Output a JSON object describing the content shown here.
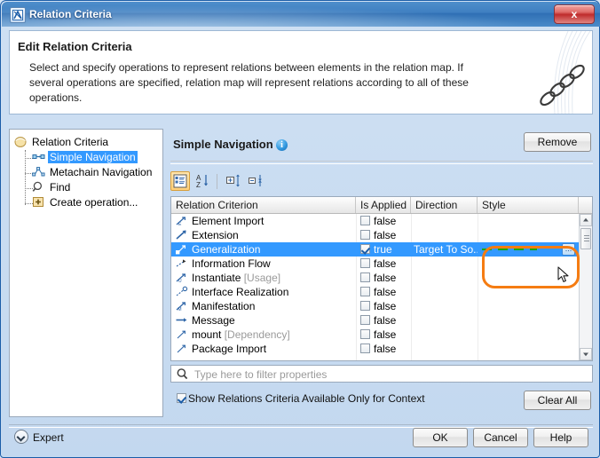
{
  "window": {
    "title": "Relation Criteria",
    "icon": "app-icon",
    "close_label": "x"
  },
  "banner": {
    "title": "Edit Relation Criteria",
    "description": "Select and specify operations to represent relations between elements in the relation map. If several operations are specified, relation map will represent relations according to all of these operations.",
    "decoration": "chain-link-image"
  },
  "tree": {
    "root": {
      "label": "Relation Criteria",
      "icon": "folder-icon"
    },
    "items": [
      {
        "label": "Simple Navigation",
        "icon": "simple-navigation-icon",
        "selected": true
      },
      {
        "label": "Metachain Navigation",
        "icon": "metachain-navigation-icon",
        "selected": false
      },
      {
        "label": "Find",
        "icon": "find-magnifier-icon",
        "selected": false
      },
      {
        "label": "Create operation...",
        "icon": "create-plus-icon",
        "selected": false
      }
    ]
  },
  "panel": {
    "section_title": "Simple Navigation",
    "info_icon_glyph": "i",
    "remove_label": "Remove",
    "toolbar": [
      {
        "name": "categorized-view-icon",
        "active": true
      },
      {
        "name": "alphabetic-sort-icon",
        "active": false
      },
      {
        "name": "expand-all-icon",
        "active": false
      },
      {
        "name": "collapse-all-icon",
        "active": false
      }
    ]
  },
  "table": {
    "columns": [
      "Relation Criterion",
      "Is Applied",
      "Direction",
      "Style"
    ],
    "rows": [
      {
        "name": "Element Import",
        "suffix": "",
        "icon": "element-import-icon",
        "applied": false,
        "applied_text": "false",
        "direction": "",
        "style": "",
        "selected": false
      },
      {
        "name": "Extension",
        "suffix": "",
        "icon": "extension-icon",
        "applied": false,
        "applied_text": "false",
        "direction": "",
        "style": "",
        "selected": false
      },
      {
        "name": "Generalization",
        "suffix": "",
        "icon": "generalization-icon",
        "applied": true,
        "applied_text": "true",
        "direction": "Target To So...",
        "style": "dashed-green-line",
        "selected": true
      },
      {
        "name": "Information Flow",
        "suffix": "",
        "icon": "information-flow-icon",
        "applied": false,
        "applied_text": "false",
        "direction": "",
        "style": "",
        "selected": false
      },
      {
        "name": "Instantiate",
        "suffix": "[Usage]",
        "icon": "instantiate-icon",
        "applied": false,
        "applied_text": "false",
        "direction": "",
        "style": "",
        "selected": false
      },
      {
        "name": "Interface Realization",
        "suffix": "",
        "icon": "interface-realization-icon",
        "applied": false,
        "applied_text": "false",
        "direction": "",
        "style": "",
        "selected": false
      },
      {
        "name": "Manifestation",
        "suffix": "",
        "icon": "manifestation-icon",
        "applied": false,
        "applied_text": "false",
        "direction": "",
        "style": "",
        "selected": false
      },
      {
        "name": "Message",
        "suffix": "",
        "icon": "message-icon",
        "applied": false,
        "applied_text": "false",
        "direction": "",
        "style": "",
        "selected": false
      },
      {
        "name": "mount",
        "suffix": "[Dependency]",
        "icon": "mount-icon",
        "applied": false,
        "applied_text": "false",
        "direction": "",
        "style": "",
        "selected": false
      },
      {
        "name": "Package Import",
        "suffix": "",
        "icon": "package-import-icon",
        "applied": false,
        "applied_text": "false",
        "direction": "",
        "style": "",
        "selected": false
      }
    ],
    "style_button_label": "...",
    "style_line_color": "#17a80c"
  },
  "filter": {
    "placeholder": "Type here to filter properties",
    "value": "",
    "icon": "search-icon"
  },
  "options": {
    "context_checkbox_label": "Show Relations Criteria Available Only for Context",
    "context_checkbox_checked": true,
    "clear_all_label": "Clear All"
  },
  "footer": {
    "expert_label": "Expert",
    "expert_icon": "chevron-down-circle-icon",
    "ok_label": "OK",
    "cancel_label": "Cancel",
    "help_label": "Help"
  },
  "annotation": {
    "highlight_color": "#f57c12",
    "cursor": "arrow-cursor"
  },
  "colors": {
    "selection": "#3399ff",
    "titlebar": "#3f7fc1",
    "accent_orange": "#f57c12"
  }
}
